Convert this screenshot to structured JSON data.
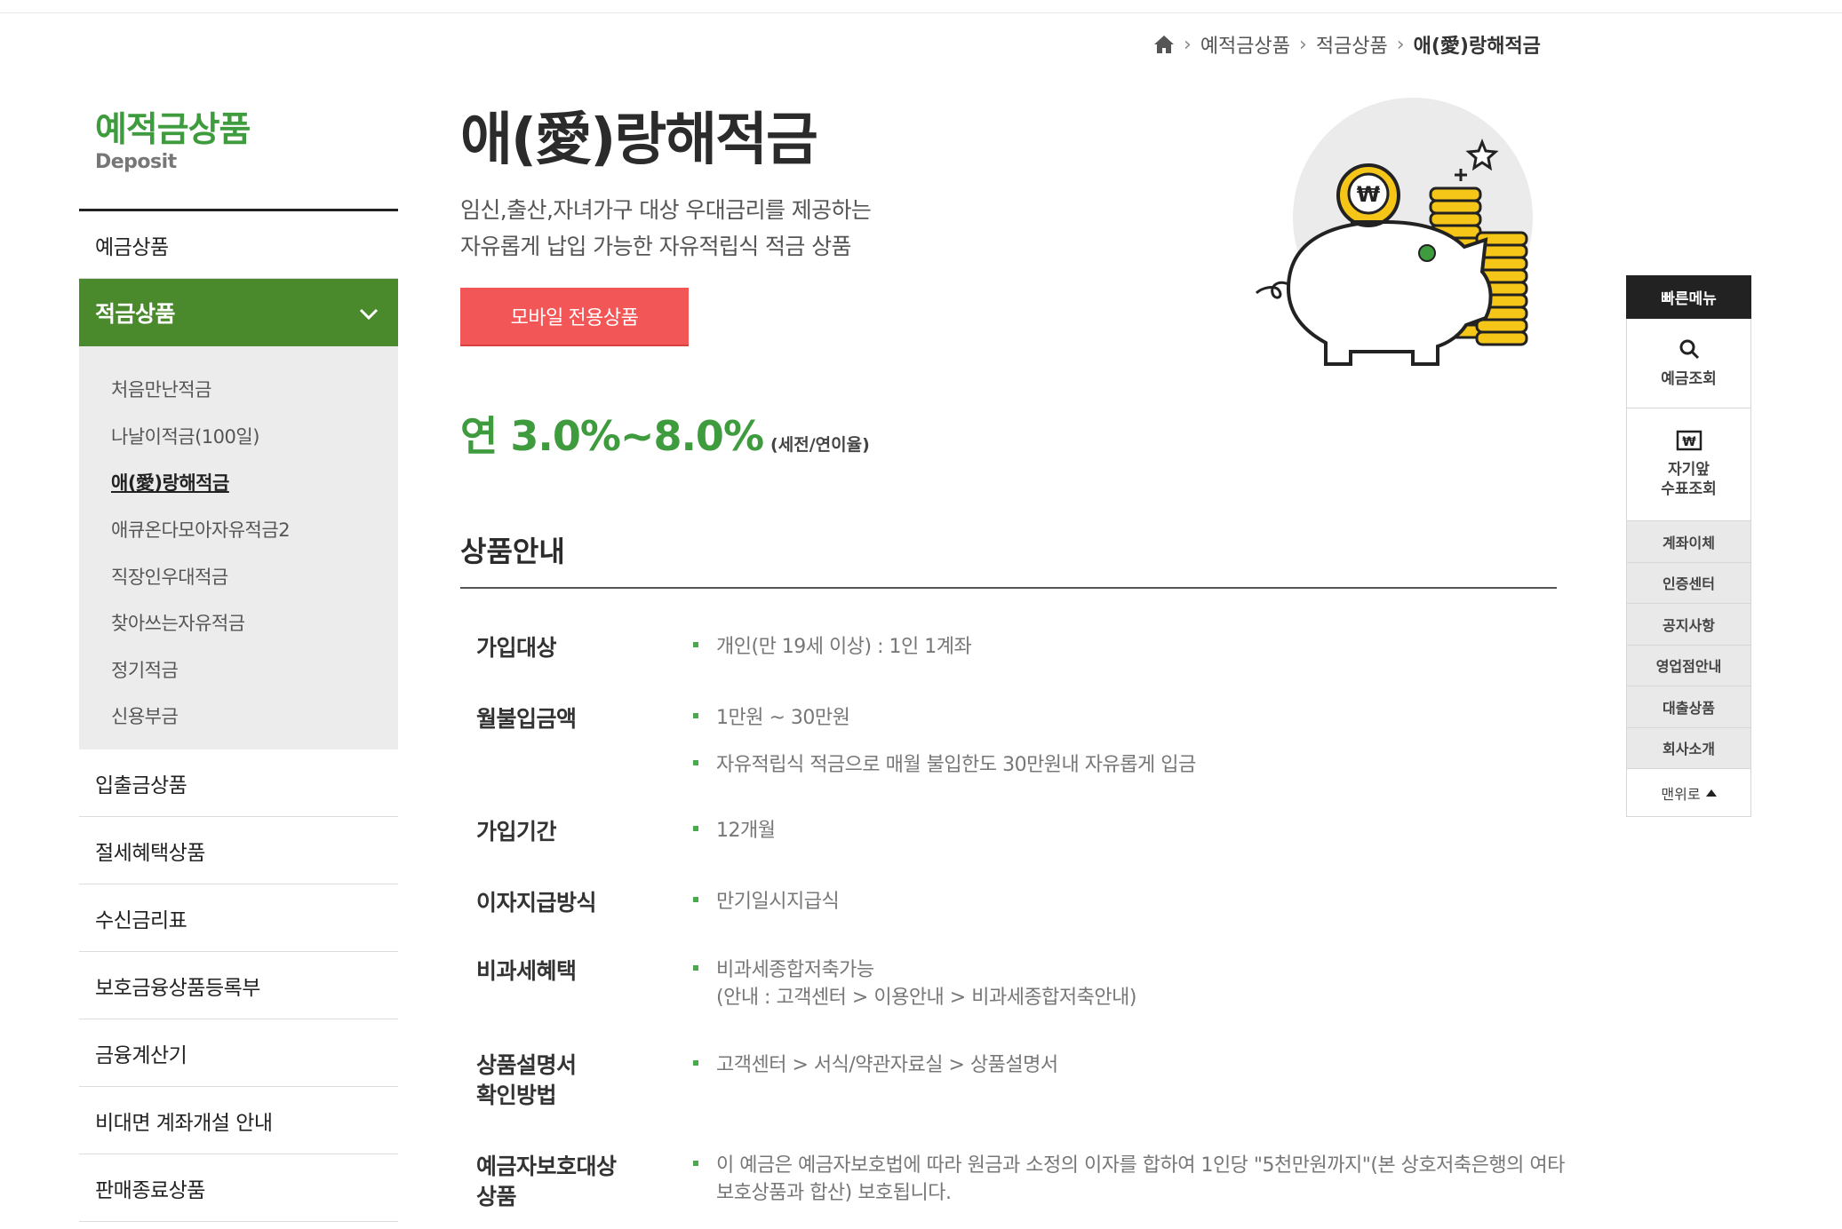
{
  "breadcrumb": {
    "items": [
      "예적금상품",
      "적금상품",
      "애(愛)랑해적금"
    ]
  },
  "sidebar": {
    "title": "예적금상품",
    "subtitle": "Deposit",
    "items": [
      {
        "label": "예금상품"
      },
      {
        "label": "적금상품"
      },
      {
        "label": "입출금상품"
      },
      {
        "label": "절세혜택상품"
      },
      {
        "label": "수신금리표"
      },
      {
        "label": "보호금융상품등록부"
      },
      {
        "label": "금융계산기"
      },
      {
        "label": "비대면 계좌개설 안내"
      },
      {
        "label": "판매종료상품"
      }
    ],
    "subitems": [
      {
        "label": "처음만난적금"
      },
      {
        "label": "나날이적금(100일)"
      },
      {
        "label": "애(愛)랑해적금"
      },
      {
        "label": "애큐온다모아자유적금2"
      },
      {
        "label": "직장인우대적금"
      },
      {
        "label": "찾아쓰는자유적금"
      },
      {
        "label": "정기적금"
      },
      {
        "label": "신용부금"
      }
    ]
  },
  "product": {
    "title": "애(愛)랑해적금",
    "desc_line1": "임신,출산,자녀가구 대상 우대금리를 제공하는",
    "desc_line2": "자유롭게 납입 가능한 자유적립식 적금 상품",
    "mobile_button": "모바일 전용상품",
    "rate": "연 3.0%~8.0%",
    "rate_note": "(세전/연이율)"
  },
  "info": {
    "section_title": "상품안내",
    "rows": [
      {
        "label": "가입대상",
        "values": [
          "개인(만 19세 이상) : 1인 1계좌"
        ]
      },
      {
        "label": "월불입금액",
        "values": [
          "1만원 ~ 30만원",
          "자유적립식 적금으로 매월 불입한도 30만원내 자유롭게 입금"
        ]
      },
      {
        "label": "가입기간",
        "values": [
          "12개월"
        ]
      },
      {
        "label": "이자지급방식",
        "values": [
          "만기일시지급식"
        ]
      },
      {
        "label": "비과세혜택",
        "values": [
          "비과세종합저축가능"
        ],
        "cont": "(안내 : 고객센터 > 이용안내 > 비과세종합저축안내)"
      },
      {
        "label_line1": "상품설명서",
        "label_line2": "확인방법",
        "values": [
          "고객센터 > 서식/약관자료실 > 상품설명서"
        ]
      },
      {
        "label_line1": "예금자보호대상",
        "label_line2": "상품",
        "values": [
          "이 예금은 예금자보호법에 따라 원금과 소정의 이자를 합하여 1인당 \"5천만원까지\"(본 상호저축은행의 여타"
        ],
        "cont": "보호상품과 합산) 보호됩니다."
      }
    ]
  },
  "quick_menu": {
    "title": "빠른메뉴",
    "box1": "예금조회",
    "box2": "자기앞\n수표조회",
    "links": [
      "계좌이체",
      "인증센터",
      "공지사항",
      "영업점안내",
      "대출상품",
      "회사소개"
    ],
    "top": "맨위로"
  },
  "colors": {
    "accent_green": "#3e9b3e",
    "menu_active": "#4a8a2c",
    "button_red": "#f25656"
  }
}
